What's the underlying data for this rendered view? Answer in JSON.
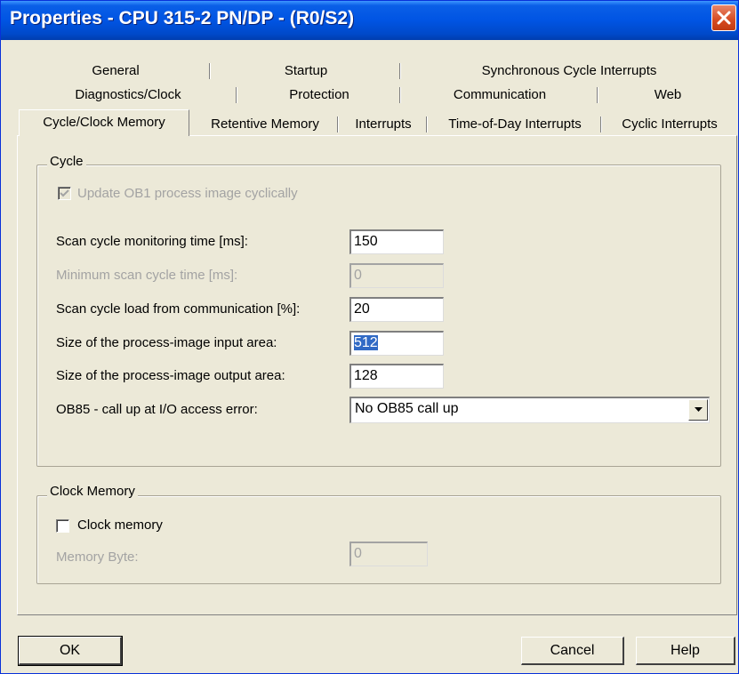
{
  "window": {
    "title": "Properties - CPU 315-2 PN/DP - (R0/S2)"
  },
  "tabs": {
    "row1": [
      "General",
      "Startup",
      "Synchronous Cycle Interrupts"
    ],
    "row2": [
      "Diagnostics/Clock",
      "Protection",
      "Communication",
      "Web"
    ],
    "row3": [
      "Cycle/Clock Memory",
      "Retentive Memory",
      "Interrupts",
      "Time-of-Day Interrupts",
      "Cyclic Interrupts"
    ],
    "active": "Cycle/Clock Memory"
  },
  "cycle": {
    "group_label": "Cycle",
    "update_ob1_label": "Update OB1 process image cyclically",
    "update_ob1_checked": true,
    "scan_monitoring_label": "Scan cycle monitoring time [ms]:",
    "scan_monitoring_value": "150",
    "min_scan_label": "Minimum scan cycle time [ms]:",
    "min_scan_value": "0",
    "scan_load_label": "Scan cycle load from communication [%]:",
    "scan_load_value": "20",
    "pi_input_label": "Size of the process-image input area:",
    "pi_input_value": "512",
    "pi_output_label": "Size of the process-image output area:",
    "pi_output_value": "128",
    "ob85_label": "OB85 - call up at I/O access error:",
    "ob85_value": "No OB85 call up"
  },
  "clock_memory": {
    "group_label": "Clock Memory",
    "checkbox_label": "Clock memory",
    "checked": false,
    "memory_byte_label": "Memory Byte:",
    "memory_byte_value": "0"
  },
  "buttons": {
    "ok": "OK",
    "cancel": "Cancel",
    "help": "Help"
  }
}
